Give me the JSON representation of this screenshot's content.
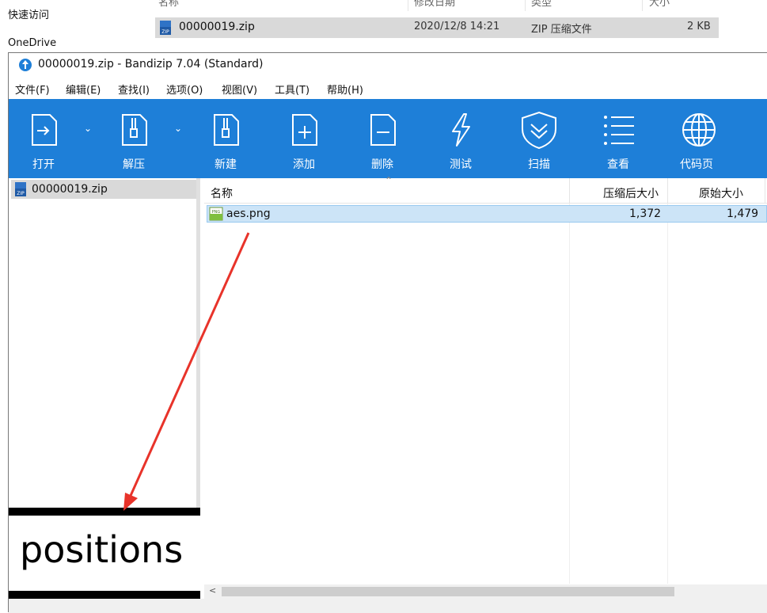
{
  "explorer": {
    "nav": {
      "quick_access": "快速访问",
      "onedrive": "OneDrive"
    },
    "columns": {
      "name": "名称",
      "modified": "修改日期",
      "type": "类型",
      "size": "大小"
    },
    "file": {
      "name": "00000019.zip",
      "modified": "2020/12/8 14:21",
      "type": "ZIP 压缩文件",
      "size": "2 KB"
    }
  },
  "window": {
    "title": "00000019.zip - Bandizip 7.04 (Standard)",
    "menu": [
      {
        "label": "文件(F)"
      },
      {
        "label": "编辑(E)"
      },
      {
        "label": "查找(I)"
      },
      {
        "label": "选项(O)"
      },
      {
        "label": "视图(V)"
      },
      {
        "label": "工具(T)"
      },
      {
        "label": "帮助(H)"
      }
    ],
    "toolbar": {
      "open": "打开",
      "extract": "解压",
      "new": "新建",
      "add": "添加",
      "delete": "删除",
      "test": "测试",
      "scan": "扫描",
      "view": "查看",
      "codepage": "代码页",
      "accent": "#1e7fd8"
    }
  },
  "tree": {
    "archive": "00000019.zip"
  },
  "annotation": {
    "text": "positions",
    "arrow_color": "#e8332a"
  },
  "list": {
    "columns": {
      "name": "名称",
      "compressed": "压缩后大小",
      "original": "原始大小"
    },
    "rows": [
      {
        "name": "aes.png",
        "compressed": "1,372",
        "original": "1,479"
      }
    ]
  }
}
